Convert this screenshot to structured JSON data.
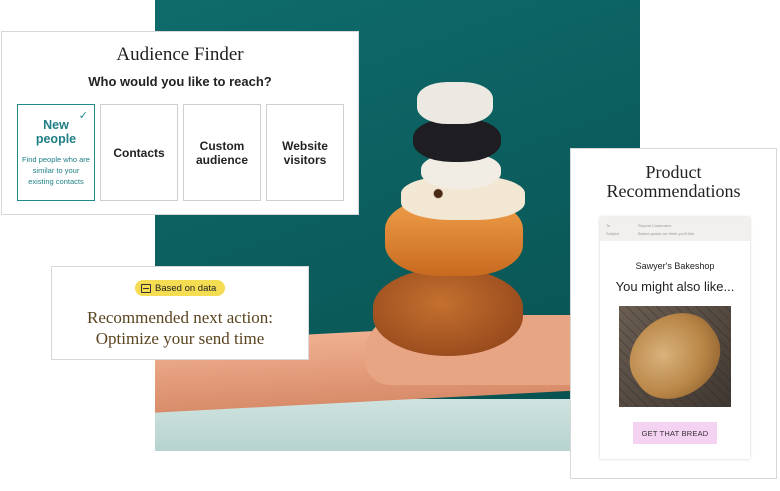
{
  "audience_finder": {
    "title": "Audience Finder",
    "question": "Who would you like to reach?",
    "options": [
      {
        "title": "New people",
        "description": "Find people who are similar to your existing contacts",
        "selected": true
      },
      {
        "title": "Contacts",
        "selected": false
      },
      {
        "title": "Custom audience",
        "selected": false
      },
      {
        "title": "Website visitors",
        "selected": false
      }
    ]
  },
  "recommendation": {
    "badge": "Based on data",
    "line1": "Recommended next action:",
    "line2": "Optimize your send time"
  },
  "product_recommendations": {
    "title_line1": "Product",
    "title_line2": "Recommendations",
    "email": {
      "to_label": "To",
      "to_value": "Repeat Customers",
      "subject_label": "Subject",
      "subject_value": "Baked goods we think you'll like",
      "shop_name": "Sawyer's Bakeshop",
      "headline": "You might also like...",
      "cta": "GET THAT BREAD"
    }
  },
  "colors": {
    "accent": "#1f8a8a",
    "badge": "#f4dc53",
    "cta": "#f4d2f2",
    "rec_text": "#5b4420",
    "photo_bg": "#0f6b6b"
  }
}
